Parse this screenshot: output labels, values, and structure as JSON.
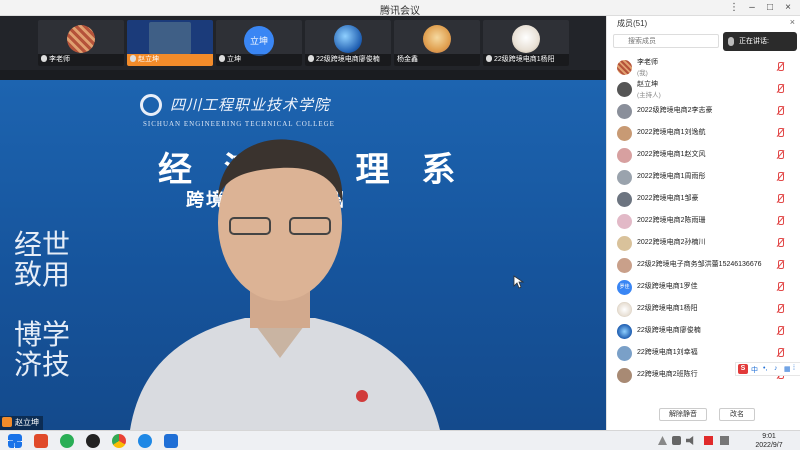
{
  "window": {
    "title": "腾讯会议"
  },
  "thumbnails": [
    {
      "name": "李老师",
      "avatar": "patterned-avatar",
      "color": "#b5533a"
    },
    {
      "name": "赵立坤",
      "avatar": "camera-video",
      "color": "#4a6f9c"
    },
    {
      "name": "立坤",
      "avatar_text": "立坤",
      "color": "#3a86f4"
    },
    {
      "name": "22级跨境电商廖俊楠",
      "avatar": "planet-avatar",
      "color": "#2a7bd1"
    },
    {
      "name": "杨金鑫",
      "avatar": "cartoon-avatar",
      "color": "#e0b36a"
    },
    {
      "name": "22级跨境电商1杨阳",
      "avatar": "pet-avatar",
      "color": "#e8e0d5"
    }
  ],
  "main_video": {
    "college_cn": "四川工程职业技术学院",
    "college_en": "SICHUAN ENGINEERING TECHNICAL COLLEGE",
    "title": "经 济 管 理 系",
    "subtitle": "跨境电商专业介绍",
    "calligraphy_left": "经世致用",
    "calligraphy_left2": "博学济技",
    "speaker_label": "赵立坤"
  },
  "panel": {
    "title": "成员(51)",
    "search_placeholder": "搜索成员",
    "speaking_label": "正在讲话:",
    "members": [
      {
        "name": "李老师",
        "role": "(我)",
        "color": "#b5533a"
      },
      {
        "name": "赵立坤",
        "role": "(主持人)",
        "color": "#555"
      },
      {
        "name": "2022级跨境电商2李志豪",
        "color": "#8a8f9a"
      },
      {
        "name": "2022跨境电商1刘逸航",
        "color": "#c89a74"
      },
      {
        "name": "2022跨境电商1赵文风",
        "color": "#d7a0a0"
      },
      {
        "name": "2022跨境电商1周雨彤",
        "color": "#9aa3ad"
      },
      {
        "name": "2022跨境电商1邹豪",
        "color": "#6c7480"
      },
      {
        "name": "2022跨境电商2陈雨珊",
        "color": "#e2b9c7"
      },
      {
        "name": "2022跨境电商2孙楠川",
        "color": "#d9c29b"
      },
      {
        "name": "22级2跨境电子商务邹洪蕾15246136676",
        "color": "#c9a08a"
      },
      {
        "name": "22级跨境电商1罗佳",
        "avatar_text": "罗佳",
        "color": "#3a86f4"
      },
      {
        "name": "22级跨境电商1杨阳",
        "color": "#e8e0d5"
      },
      {
        "name": "22级跨境电商廖俊楠",
        "color": "#2a7bd1"
      },
      {
        "name": "22跨境电商1刘幸福",
        "color": "#7aa0c8"
      },
      {
        "name": "22跨境电商2班陈行",
        "color": "#a88a74"
      }
    ],
    "unmute_all": "解除静音",
    "rename": "改名",
    "ime": {
      "logo": "S",
      "lang": "中"
    }
  },
  "taskbar": {
    "time": "9:01",
    "date": "2022/9/7"
  }
}
